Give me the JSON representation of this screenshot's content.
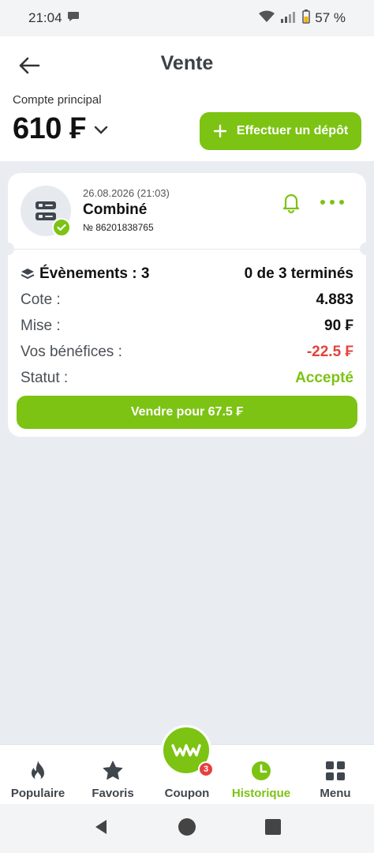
{
  "status_bar": {
    "time": "21:04",
    "battery": "57 %"
  },
  "header": {
    "title": "Vente",
    "account_label": "Compte principal",
    "balance": "610 ₣",
    "deposit_label": "Effectuer un dépôt"
  },
  "bet": {
    "date": "26.08.2026 (21:03)",
    "type": "Combiné",
    "number": "№ 86201838765",
    "events_label": "Évènements : 3",
    "events_status": "0 de 3 terminés",
    "rows": [
      {
        "label": "Cote :",
        "value": "4.883"
      },
      {
        "label": "Mise :",
        "value": "90 ₣"
      },
      {
        "label": "Vos bénéfices :",
        "value": "-22.5 ₣"
      },
      {
        "label": "Statut :",
        "value": "Accepté"
      }
    ],
    "sell_label": "Vendre pour 67.5 ₣"
  },
  "bottom_nav": {
    "items": [
      {
        "label": "Populaire",
        "icon": "fire-icon"
      },
      {
        "label": "Favoris",
        "icon": "star-icon"
      },
      {
        "label": "Coupon",
        "icon": "coupon-logo-icon"
      },
      {
        "label": "Historique",
        "icon": "clock-icon"
      },
      {
        "label": "Menu",
        "icon": "grid-icon"
      }
    ],
    "coupon_badge": "3",
    "active": "Historique"
  },
  "colors": {
    "accent": "#7cc313",
    "negative": "#e5413d"
  }
}
